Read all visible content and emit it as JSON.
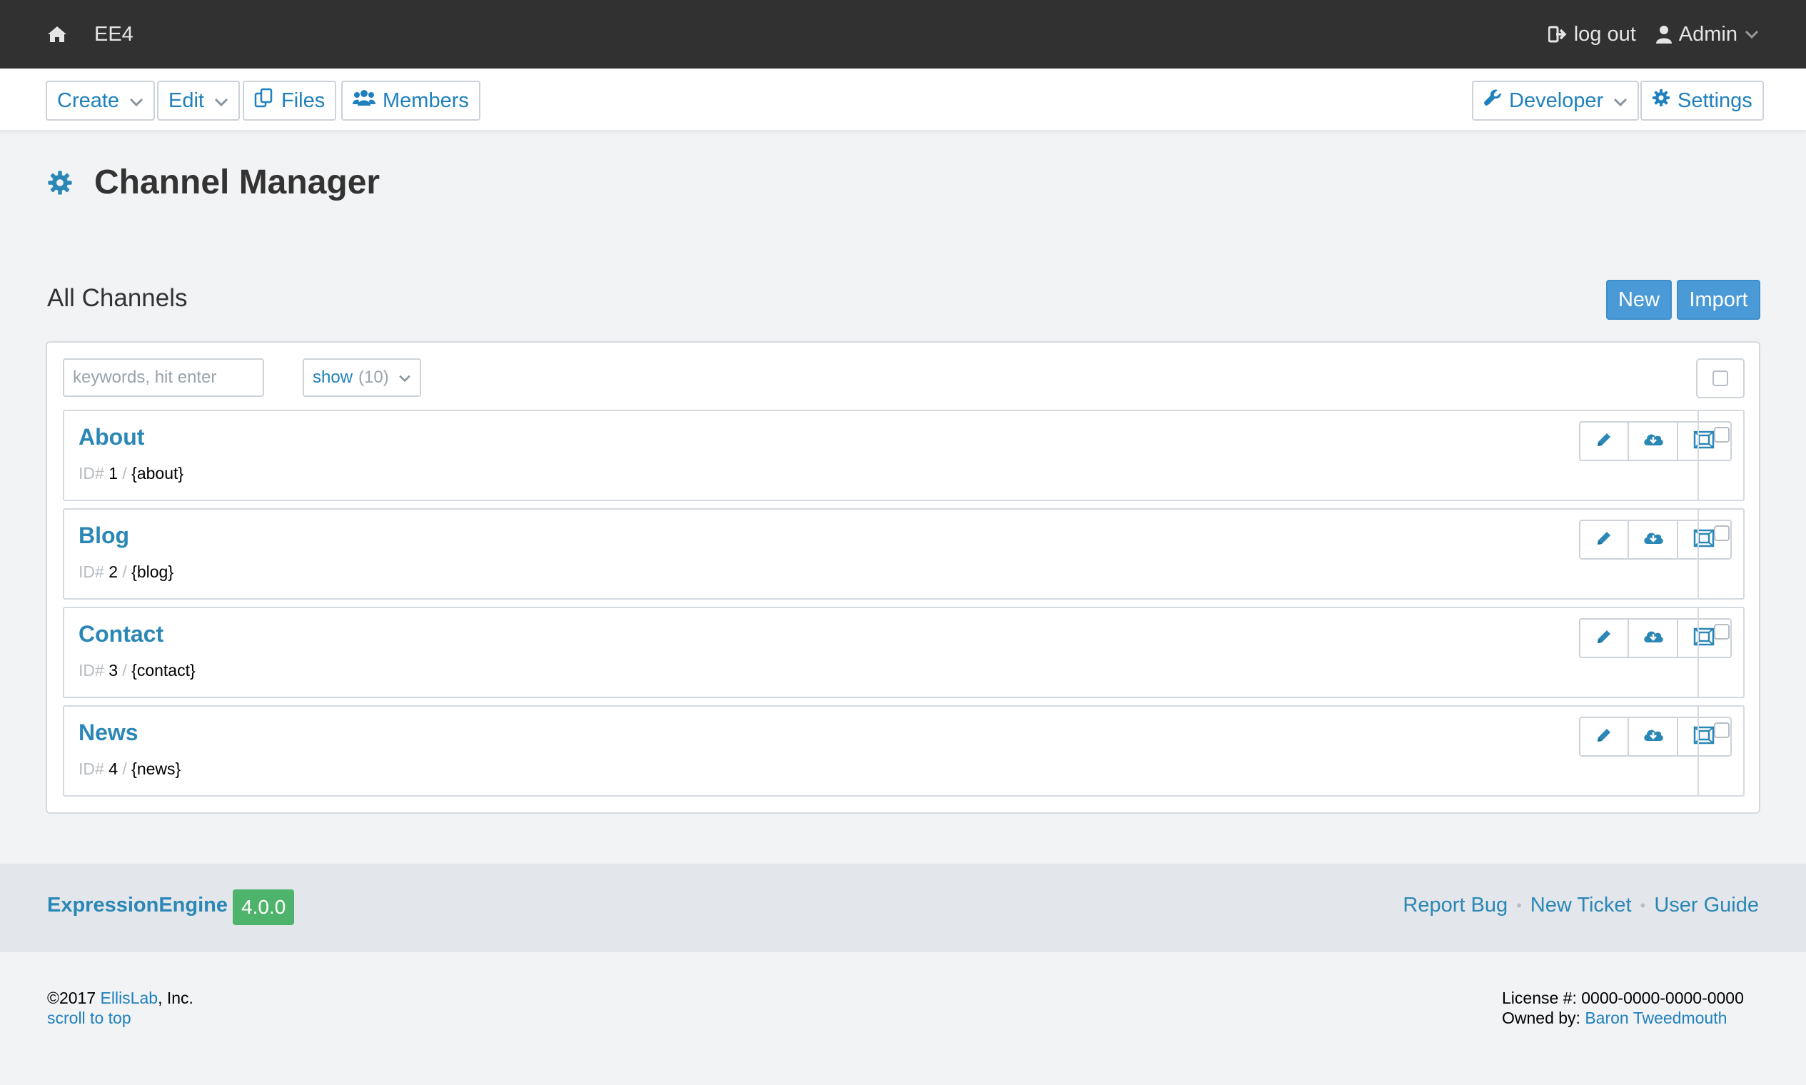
{
  "topbar": {
    "site_name": "EE4",
    "logout_label": "log out",
    "user_label": "Admin"
  },
  "nav": {
    "create": "Create",
    "edit": "Edit",
    "files": "Files",
    "members": "Members",
    "developer": "Developer",
    "settings": "Settings"
  },
  "page": {
    "title": "Channel Manager",
    "section": "All Channels",
    "new_button": "New",
    "import_button": "Import"
  },
  "filters": {
    "search_placeholder": "keywords, hit enter",
    "show_label": "show",
    "show_count": "(10)"
  },
  "channels": [
    {
      "name": "About",
      "id_label": "ID#",
      "id": "1",
      "sep": "/",
      "short": "{about}"
    },
    {
      "name": "Blog",
      "id_label": "ID#",
      "id": "2",
      "sep": "/",
      "short": "{blog}"
    },
    {
      "name": "Contact",
      "id_label": "ID#",
      "id": "3",
      "sep": "/",
      "short": "{contact}"
    },
    {
      "name": "News",
      "id_label": "ID#",
      "id": "4",
      "sep": "/",
      "short": "{news}"
    }
  ],
  "row_tools": [
    "pencil-icon",
    "cloud-download-icon",
    "layout-icon"
  ],
  "footer": {
    "brand": "ExpressionEngine",
    "version": "4.0.0",
    "links": [
      "Report Bug",
      "New Ticket",
      "User Guide"
    ],
    "link_sep": "•",
    "copyright_prefix": "©2017",
    "company": "EllisLab",
    "company_suffix": ", Inc.",
    "scroll_top": "scroll to top",
    "license_label": "License #:",
    "license": "0000-0000-0000-0000",
    "owner_label": "Owned by:",
    "owner": "Baron Tweedmouth"
  },
  "colors": {
    "accent": "#1f80bd",
    "title_link": "#2a87b6",
    "primary_button": "#4a9ad8",
    "version_badge": "#4fb46b",
    "topbar": "#313131"
  }
}
